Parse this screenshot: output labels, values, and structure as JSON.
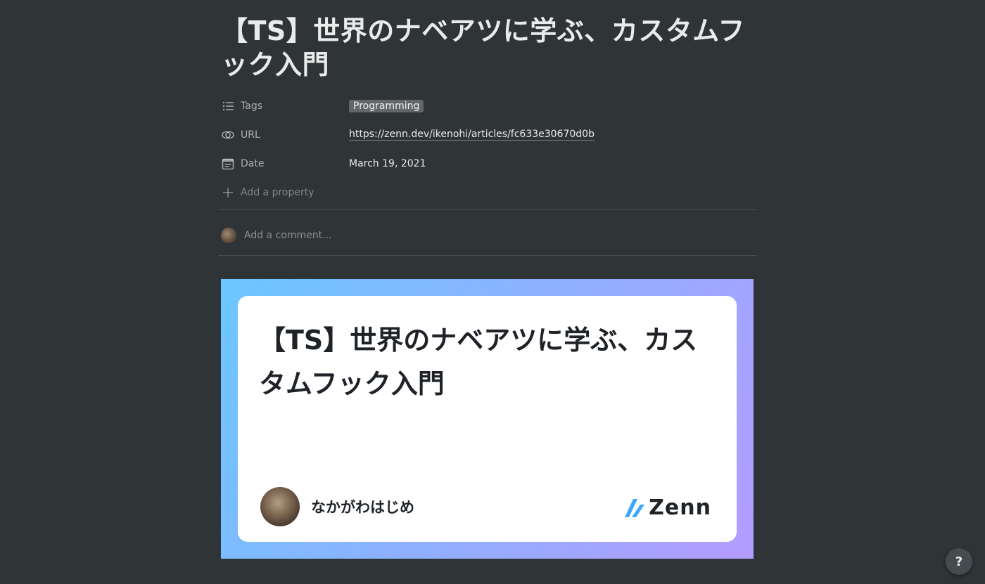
{
  "page": {
    "title": "【TS】世界のナベアツに学ぶ、カスタムフック入門"
  },
  "properties": [
    {
      "name": "Tags",
      "icon": "list-icon",
      "value": "Programming"
    },
    {
      "name": "URL",
      "icon": "link-icon",
      "value": "https://zenn.dev/ikenohi/articles/fc633e30670d0b"
    },
    {
      "name": "Date",
      "icon": "calendar-icon",
      "value": "March 19, 2021"
    }
  ],
  "add_property_label": "Add a property",
  "comment": {
    "placeholder": "Add a comment..."
  },
  "og_card": {
    "title": "【TS】世界のナベアツに学ぶ、カスタムフック入門",
    "author": "なかがわはじめ",
    "brand": "Zenn"
  },
  "help_label": "?",
  "colors": {
    "background": "#2f3437",
    "brand_blue": "#3ea8ff"
  }
}
